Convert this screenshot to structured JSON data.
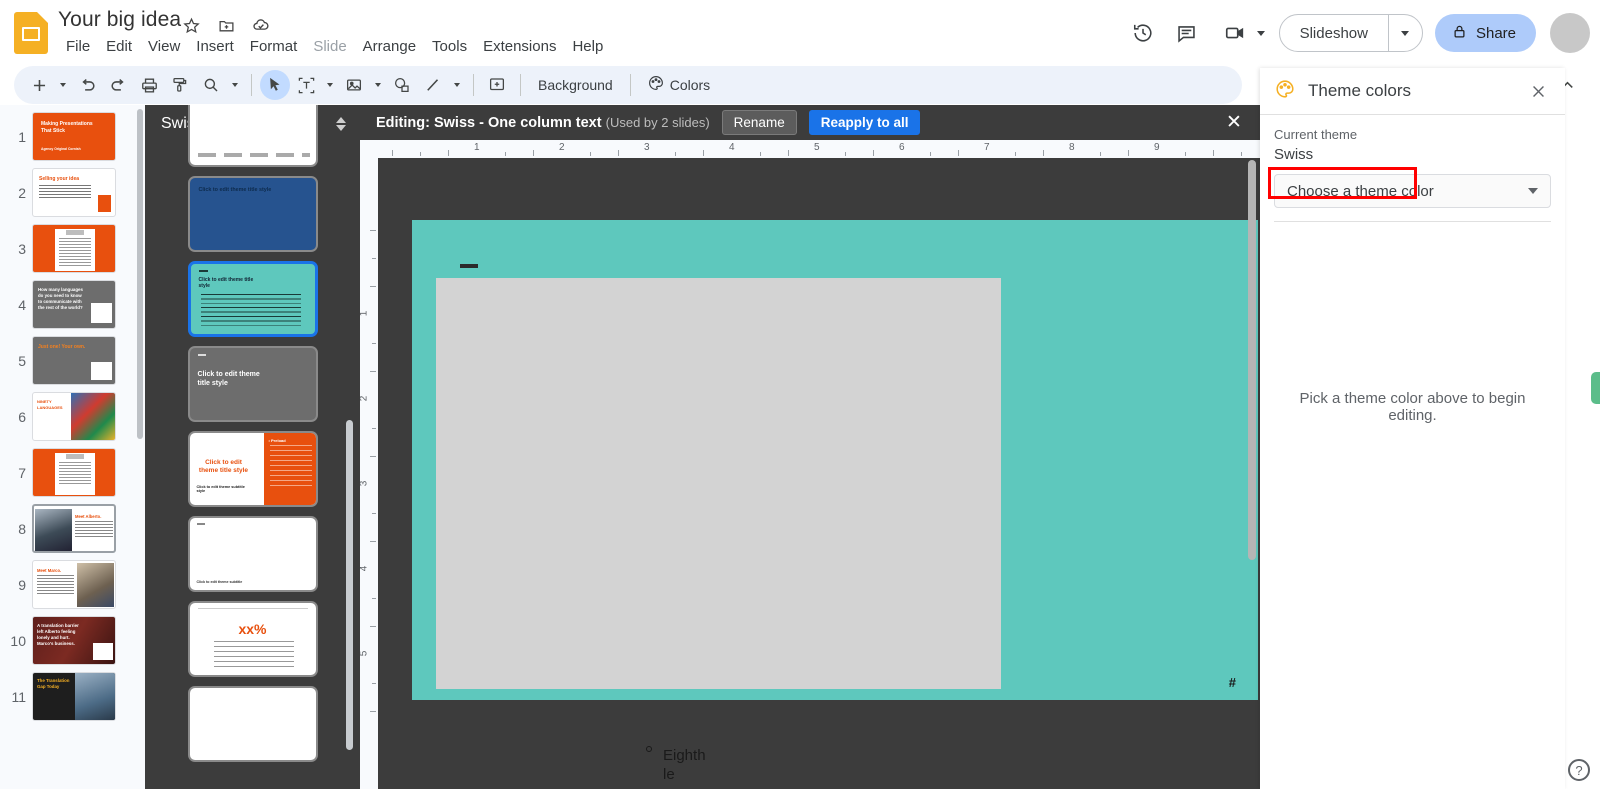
{
  "app": {
    "doc_title": "Your big idea",
    "doc_icon": "slides-doc-icon",
    "title_icons": [
      "star-icon",
      "move-to-folder-icon",
      "cloud-saved-icon"
    ],
    "menus": [
      {
        "label": "File",
        "dim": false
      },
      {
        "label": "Edit",
        "dim": false
      },
      {
        "label": "View",
        "dim": false
      },
      {
        "label": "Insert",
        "dim": false
      },
      {
        "label": "Format",
        "dim": false
      },
      {
        "label": "Slide",
        "dim": true
      },
      {
        "label": "Arrange",
        "dim": false
      },
      {
        "label": "Tools",
        "dim": false
      },
      {
        "label": "Extensions",
        "dim": false
      },
      {
        "label": "Help",
        "dim": false
      }
    ]
  },
  "topright": {
    "history_icon": "version-history-icon",
    "comment_icon": "comment-icon",
    "meet_icon": "meet-video-icon",
    "slideshow_label": "Slideshow",
    "share_label": "Share",
    "share_lock_icon": "lock-icon",
    "avatar": "user-avatar"
  },
  "toolbar": {
    "background_label": "Background",
    "colors_label": "Colors",
    "icons": [
      "plus-icon",
      "undo-icon",
      "redo-icon",
      "print-icon",
      "paint-format-icon",
      "zoom-icon",
      "select-cursor-icon",
      "text-box-icon",
      "image-icon",
      "shape-icon",
      "line-icon",
      "comment-add-icon",
      "palette-icon",
      "collapse-toolbar-icon"
    ]
  },
  "filmstrip": {
    "slides": [
      {
        "number": "1",
        "title": "Making Presentations That Stick",
        "subtitle": "Agency Original Cornish",
        "style": "orange-title"
      },
      {
        "number": "2",
        "title": "Selling your idea",
        "style": "white-body-image"
      },
      {
        "number": "3",
        "title": "",
        "style": "orange-doc"
      },
      {
        "number": "4",
        "title": "How many languages do you need to know to communicate with the rest of the world?",
        "style": "gray-question"
      },
      {
        "number": "5",
        "title": "Just one! Your own.",
        "style": "gray-answer"
      },
      {
        "number": "6",
        "title": "NINETY LANGUAGES",
        "style": "white-flags-photo"
      },
      {
        "number": "7",
        "title": "",
        "style": "orange-doc"
      },
      {
        "number": "8",
        "title": "Meet Alberto.",
        "style": "white-photo-left",
        "selected": true
      },
      {
        "number": "9",
        "title": "Meet Marco.",
        "style": "white-photo-right"
      },
      {
        "number": "10",
        "title": "A translation barrier left Alberto feeling lonely and hurt. Marco's business.",
        "style": "maroon-photo"
      },
      {
        "number": "11",
        "title": "The Translation Gap Today",
        "style": "dark-photo"
      }
    ]
  },
  "layouts_panel": {
    "title": "Swiss",
    "sort_icon": "sort-arrows-icon",
    "items": [
      {
        "name": "partial-top-layout",
        "title": "",
        "style": "white"
      },
      {
        "name": "blue-title-layout",
        "title": "Click to edit theme title style",
        "style": "blue"
      },
      {
        "name": "one-column-text-layout",
        "title": "Click to edit theme title style",
        "style": "teal",
        "selected": true
      },
      {
        "name": "gray-title-layout",
        "title": "Click to edit theme title style",
        "style": "gray"
      },
      {
        "name": "orange-split-layout",
        "title": "Click to edit theme title style",
        "subtitle": "Click to edit theme subtitle style",
        "style": "orange-split"
      },
      {
        "name": "white-caption-layout",
        "title": "",
        "style": "white-caption"
      },
      {
        "name": "big-number-layout",
        "title": "xx%",
        "style": "white-number"
      },
      {
        "name": "blank-layout",
        "title": "",
        "style": "blank"
      }
    ]
  },
  "editbar": {
    "text": "Editing: Swiss - One column text",
    "usage": "(Used by 2 slides)",
    "rename_label": "Rename",
    "reapply_label": "Reapply to all",
    "close_icon": "close-icon"
  },
  "canvas": {
    "ruler_h_labels": [
      "1",
      "2",
      "3",
      "4",
      "5",
      "6",
      "7",
      "8",
      "9"
    ],
    "ruler_v_labels": [
      "1",
      "2",
      "3",
      "4",
      "5"
    ],
    "slide_bg_color": "#5ec8bd",
    "placeholder_color": "#d3d3d3",
    "slide_number_placeholder": "#",
    "overflow_text": "Eighth le",
    "overflow_bullet_icon": "hollow-bullet-icon"
  },
  "theme_panel": {
    "icon": "palette-icon",
    "title": "Theme colors",
    "close_icon": "close-icon",
    "current_theme_label": "Current theme",
    "current_theme_value": "Swiss",
    "select_value": "Choose a theme color",
    "select_caret_icon": "chevron-down-icon",
    "hint": "Pick a theme color above to begin editing.",
    "highlight_color": "#ff0000",
    "side_tab_color": "#5bbd8a",
    "help_icon": "help-icon"
  }
}
